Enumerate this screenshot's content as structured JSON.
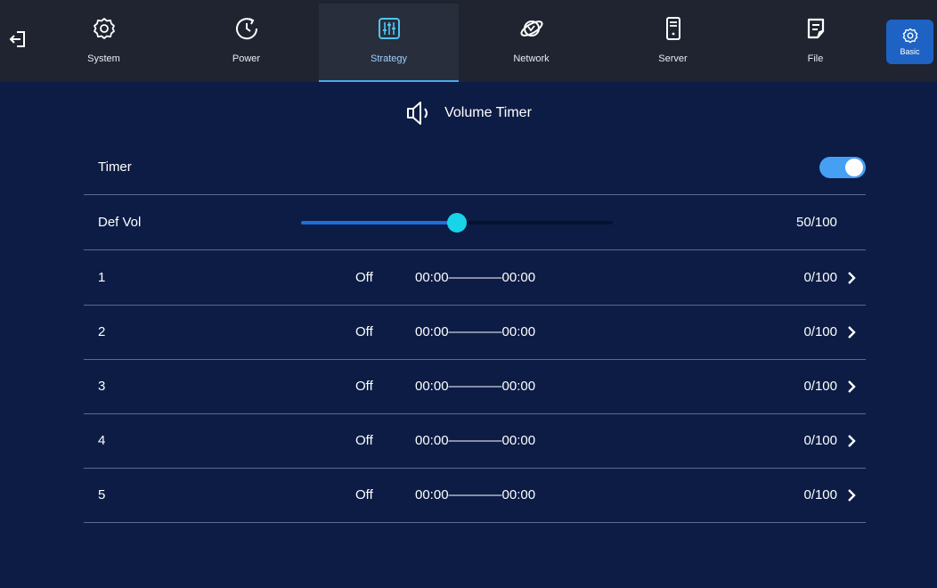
{
  "colors": {
    "background": "#0c1c45",
    "topbar": "#1f2430",
    "accent": "#45a0f4",
    "thumb": "#19d3e8"
  },
  "nav": {
    "exit_icon": "exit-icon",
    "tabs": [
      {
        "label": "System",
        "icon": "gear-icon",
        "active": false
      },
      {
        "label": "Power",
        "icon": "power-timer-icon",
        "active": false
      },
      {
        "label": "Strategy",
        "icon": "equalizer-icon",
        "active": true
      },
      {
        "label": "Network",
        "icon": "globe-icon",
        "active": false
      },
      {
        "label": "Server",
        "icon": "server-icon",
        "active": false
      },
      {
        "label": "File",
        "icon": "file-icon",
        "active": false
      }
    ],
    "basic": {
      "label": "Basic",
      "icon": "gear-icon"
    }
  },
  "page": {
    "title": "Volume Timer",
    "title_icon": "speaker-icon"
  },
  "timer": {
    "label": "Timer",
    "enabled": true
  },
  "def_vol": {
    "label": "Def Vol",
    "value": 50,
    "max": 100,
    "text": "50/100"
  },
  "schedules": [
    {
      "index": "1",
      "state": "Off",
      "time": "00:00————00:00",
      "volume": "0/100"
    },
    {
      "index": "2",
      "state": "Off",
      "time": "00:00————00:00",
      "volume": "0/100"
    },
    {
      "index": "3",
      "state": "Off",
      "time": "00:00————00:00",
      "volume": "0/100"
    },
    {
      "index": "4",
      "state": "Off",
      "time": "00:00————00:00",
      "volume": "0/100"
    },
    {
      "index": "5",
      "state": "Off",
      "time": "00:00————00:00",
      "volume": "0/100"
    }
  ]
}
